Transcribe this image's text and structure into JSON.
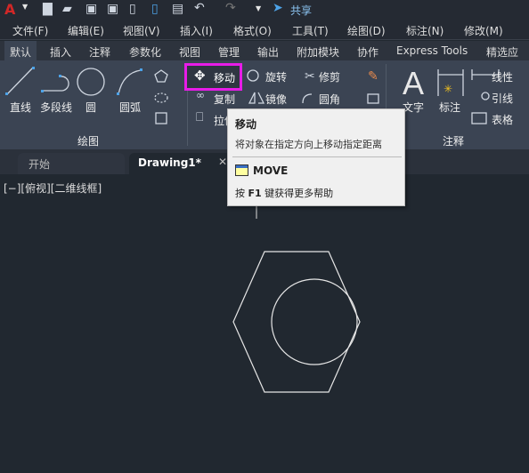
{
  "qat": {
    "share_label": "共享",
    "icons": [
      "autocad-logo-icon",
      "new-icon",
      "open-icon",
      "save-icon",
      "save-as-icon",
      "open-web-icon",
      "save-web-icon",
      "plot-icon",
      "undo-icon",
      "redo-icon",
      "customize-icon",
      "share-icon"
    ]
  },
  "menu": [
    "文件(F)",
    "编辑(E)",
    "视图(V)",
    "插入(I)",
    "格式(O)",
    "工具(T)",
    "绘图(D)",
    "标注(N)",
    "修改(M)"
  ],
  "ribbon_tabs": [
    "默认",
    "插入",
    "注释",
    "参数化",
    "视图",
    "管理",
    "输出",
    "附加模块",
    "协作",
    "Express Tools",
    "精选应用"
  ],
  "draw_panel": {
    "title": "绘图",
    "tools": [
      "直线",
      "多段线",
      "圆",
      "圆弧"
    ]
  },
  "modify_panel": {
    "tools": [
      "移动",
      "旋转",
      "修剪",
      "复制",
      "镜像",
      "圆角",
      "拉伸"
    ]
  },
  "annotation_panel": {
    "title": "注释",
    "tools": [
      "文字",
      "标注",
      "线性",
      "引线",
      "表格"
    ]
  },
  "doc_tabs": [
    {
      "label": "开始"
    },
    {
      "label": "Drawing1*",
      "active": true
    }
  ],
  "viewport_label": "[−][俯视][二维线框]",
  "tooltip": {
    "title": "移动",
    "description": "将对象在指定方向上移动指定距离",
    "command": "MOVE",
    "help": "按 F1 键获得更多帮助",
    "help_prefix": "按",
    "help_key": "F1",
    "help_suffix": "键获得更多帮助"
  },
  "colors": {
    "highlight": "#e81ce8",
    "accent": "#4da3e8",
    "canvas": "#212830"
  }
}
